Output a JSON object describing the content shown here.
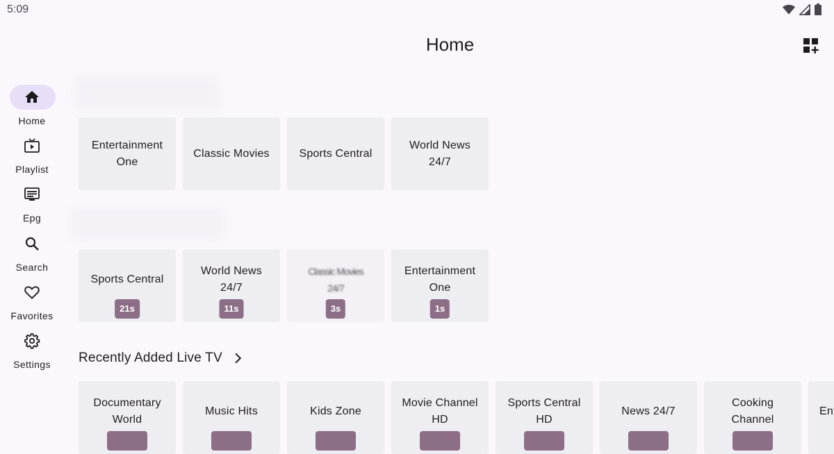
{
  "status_bar": {
    "time": "5:09",
    "icons": [
      "wifi-icon",
      "signal-icon",
      "battery-icon"
    ]
  },
  "header": {
    "title": "Home",
    "action_icon": "add-widget-icon"
  },
  "nav": {
    "items": [
      {
        "label": "Home",
        "icon": "home-icon",
        "active": true
      },
      {
        "label": "Playlist",
        "icon": "playlist-tv-icon",
        "active": false
      },
      {
        "label": "Epg",
        "icon": "epg-icon",
        "active": false
      },
      {
        "label": "Search",
        "icon": "search-icon",
        "active": false
      },
      {
        "label": "Favorites",
        "icon": "heart-icon",
        "active": false
      },
      {
        "label": "Settings",
        "icon": "gear-icon",
        "active": false
      }
    ]
  },
  "rows": [
    {
      "cards": [
        {
          "title": "Entertainment\nOne"
        },
        {
          "title": "Classic Movies"
        },
        {
          "title": "Sports Central"
        },
        {
          "title": "World News\n24/7"
        }
      ]
    },
    {
      "cards": [
        {
          "title": "Sports Central",
          "badge": "21s"
        },
        {
          "title": "World News\n24/7",
          "badge": "11s"
        },
        {
          "title": "Classic Movies\n24/7",
          "badge": "3s"
        },
        {
          "title": "Entertainment\nOne",
          "badge": "1s"
        }
      ]
    },
    {
      "title": "Recently Added Live TV",
      "cards": [
        {
          "title": "Documentary\nWorld"
        },
        {
          "title": "Music Hits"
        },
        {
          "title": "Kids Zone"
        },
        {
          "title": "Movie Channel\nHD"
        },
        {
          "title": "Sports Central\nHD"
        },
        {
          "title": "News 24/7"
        },
        {
          "title": "Cooking\nChannel"
        },
        {
          "title": "Ent"
        }
      ]
    }
  ],
  "colors": {
    "accent": "#e8def8",
    "badge": "#8c6f86",
    "card": "#eeedf1",
    "background": "#fbf8fd"
  }
}
